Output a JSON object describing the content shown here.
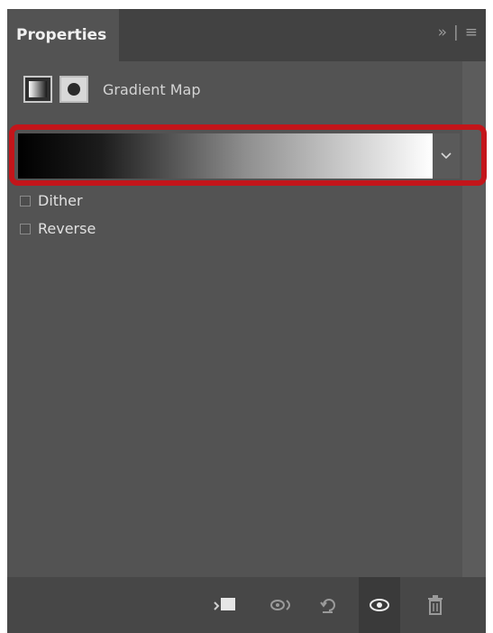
{
  "panel": {
    "title": "Properties",
    "tab_controls": {
      "collapse": "»",
      "separator": "|",
      "menu": "≡"
    }
  },
  "header": {
    "adjustment_icon": "gradient-map-adjustment-icon",
    "mask_icon": "layer-mask-icon",
    "label": "Gradient Map"
  },
  "gradient": {
    "stops": [
      "#000000",
      "#ffffff"
    ],
    "dropdown_icon": "chevron-down-icon"
  },
  "options": [
    {
      "label": "Dither",
      "checked": false
    },
    {
      "label": "Reverse",
      "checked": false
    }
  ],
  "highlight_color": "#c3151a",
  "bottom_toolbar": [
    {
      "name": "clip-to-layer-icon"
    },
    {
      "name": "view-previous-state-icon"
    },
    {
      "name": "reset-icon"
    },
    {
      "name": "visibility-eye-icon",
      "active": true
    },
    {
      "name": "trash-icon"
    }
  ]
}
